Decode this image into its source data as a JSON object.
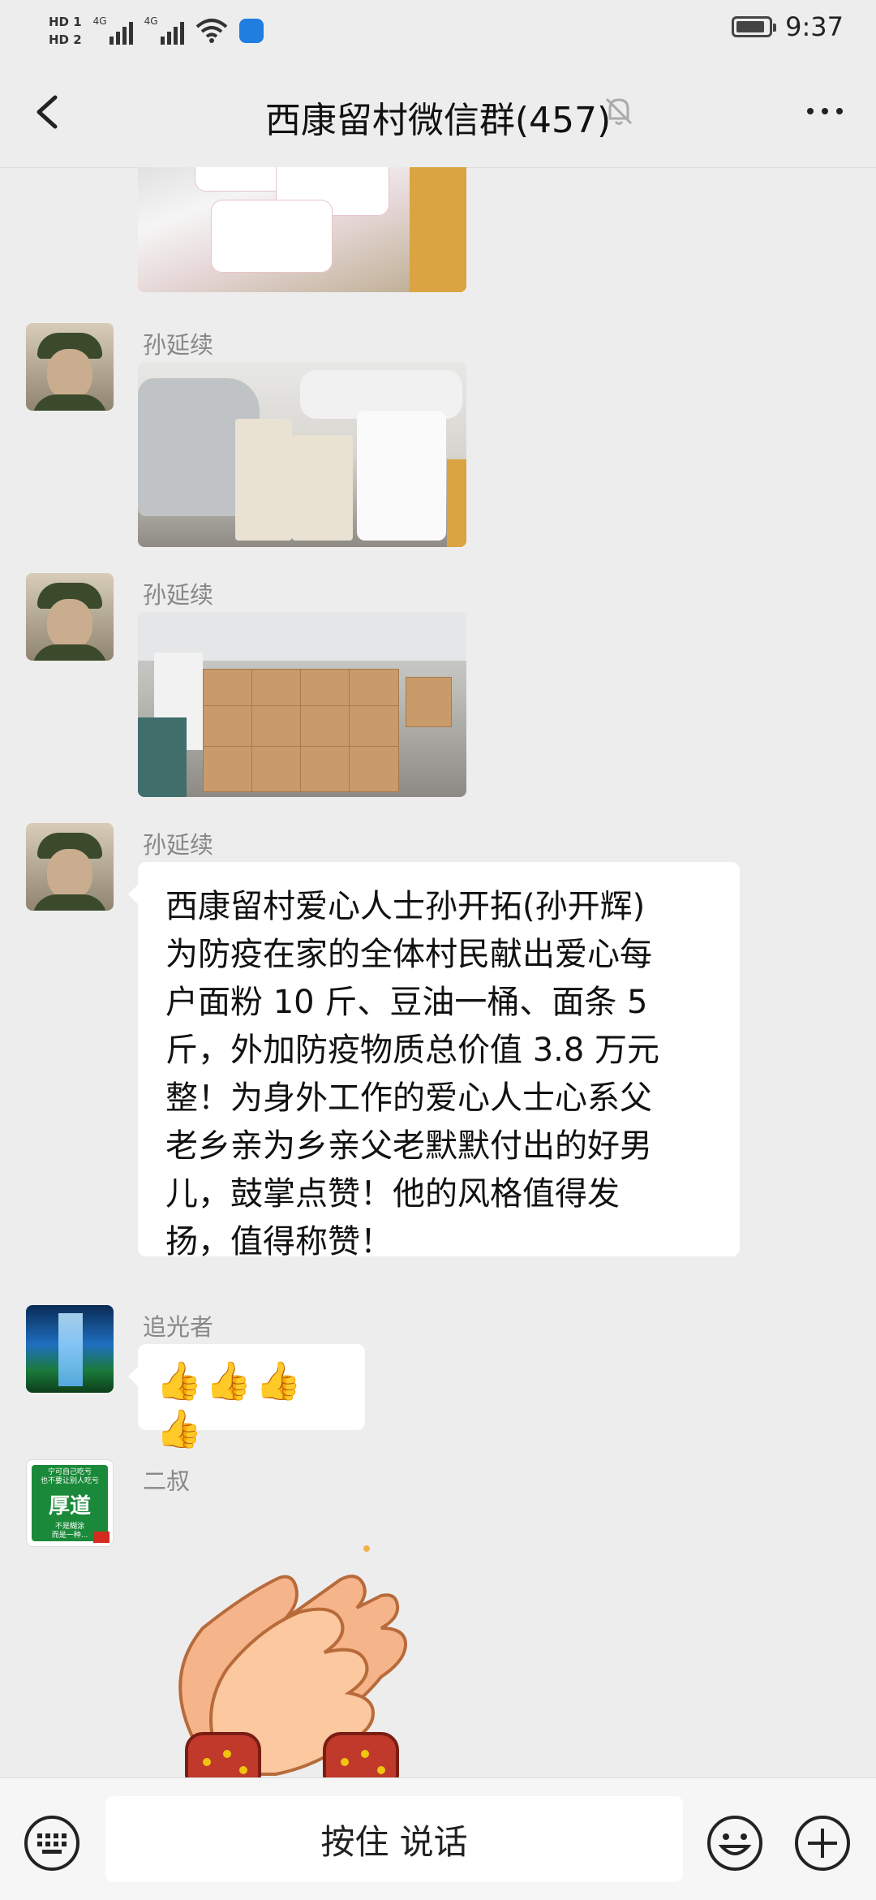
{
  "status_bar": {
    "sim1_label": "HD 1",
    "sim2_label": "HD 2",
    "network1": "4G",
    "network2": "4G",
    "time": "9:37",
    "battery_level": 0.9
  },
  "header": {
    "title": "西康留村微信群(457)",
    "back_icon": "chevron-left-icon",
    "mute_icon": "bell-off-icon",
    "more_icon": "more-dots-icon"
  },
  "messages": [
    {
      "type": "image",
      "description_icon": "photo-sacks-of-flour"
    },
    {
      "type": "image",
      "sender": "孙延续",
      "description_icon": "photo-flour-and-noodle-stacks"
    },
    {
      "type": "image",
      "sender": "孙延续",
      "description_icon": "photo-cardboard-boxes"
    },
    {
      "type": "text",
      "sender": "孙延续",
      "text": "西康留村爱心人士孙开拓(孙开辉)\n为防疫在家的全体村民献出爱心每\n户面粉 10 斤、豆油一桶、面条 5\n斤，外加防疫物质总价值 3.8 万元\n整！为身外工作的爱心人士心系父\n老乡亲为乡亲父老默默付出的好男\n儿，鼓掌点赞！他的风格值得发\n扬，值得称赞！"
    },
    {
      "type": "text",
      "sender": "追光者",
      "text": "👍👍👍👍"
    },
    {
      "type": "sticker",
      "sender": "二叔",
      "description_icon": "clapping-hands-sticker"
    }
  ],
  "avatars": {
    "sun_yanxu_text": "",
    "erhsu_plate_small_top": "宁可自己吃亏\n也不要让别人吃亏",
    "erhsu_plate_big": "厚道",
    "erhsu_plate_small_bottom": "不是糊涂\n而是一种..."
  },
  "input_bar": {
    "voice_label": "按住 说话",
    "keyboard_icon": "keyboard-icon",
    "emoji_icon": "emoji-smile-icon",
    "plus_icon": "plus-circle-icon"
  },
  "colors": {
    "background": "#ededed",
    "bubble": "#ffffff",
    "sender_text": "#888888"
  }
}
